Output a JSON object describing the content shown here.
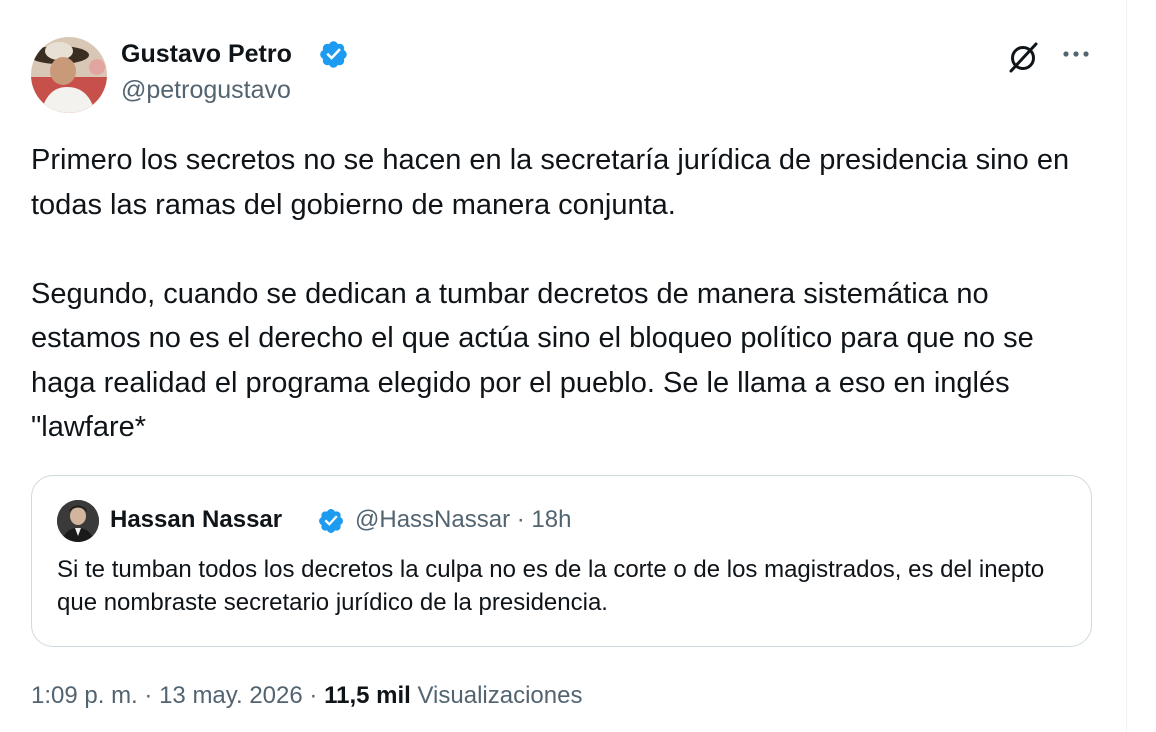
{
  "author": {
    "name": "Gustavo Petro",
    "handle": "@petrogustavo",
    "verified": true,
    "avatar_icon": "profile-photo-icon"
  },
  "actions": {
    "grok_icon": "grok-slash-circle-icon",
    "more_icon": "more-dots-icon"
  },
  "tweet": {
    "text": "Primero los secretos no se hacen en la secretaría jurídica de presidencia sino en todas las ramas del gobierno de manera conjunta.\n\nSegundo, cuando se dedican a tumbar decretos de manera sistemática no estamos no es el derecho el que actúa sino el bloqueo político para que no se haga realidad el programa elegido por el pueblo. Se le llama a eso en inglés \"lawfare*"
  },
  "quote": {
    "name": "Hassan Nassar",
    "handle": "@HassNassar",
    "separator": "·",
    "time": "18h",
    "verified": true,
    "text": "Si te tumban todos los decretos la culpa no es de la corte o de los magistrados, es del inepto que nombraste secretario jurídico de la presidencia."
  },
  "footer": {
    "time": "1:09 p. m.",
    "separator1": "·",
    "date": "13 may. 2026",
    "separator2": "·",
    "views_count": "11,5 mil",
    "views_label": "Visualizaciones"
  },
  "colors": {
    "text": "#0f1419",
    "secondary": "#536471",
    "verified_blue": "#1d9bf0",
    "border": "#cfd9de"
  }
}
